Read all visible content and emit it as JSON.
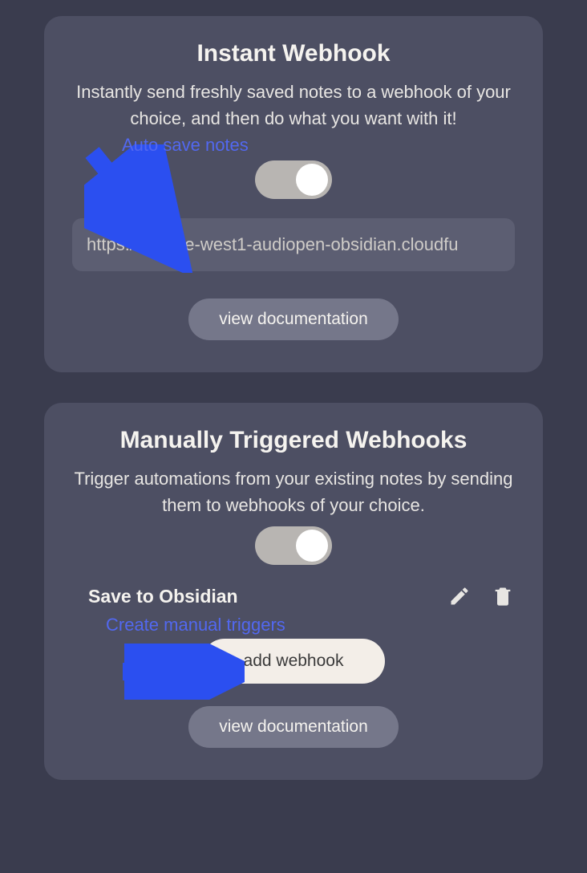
{
  "instant": {
    "title": "Instant Webhook",
    "description": "Instantly send freshly saved notes to a webhook of your choice, and then do what you want with it!",
    "annotation_label": "Auto save notes",
    "toggle_on": true,
    "url_value": "https://europe-west1-audiopen-obsidian.cloudfu",
    "doc_button": "view documentation"
  },
  "manual": {
    "title": "Manually Triggered Webhooks",
    "description": "Trigger automations from your existing notes by sending them to webhooks of your choice.",
    "toggle_on": true,
    "webhooks": [
      {
        "name": "Save to Obsidian"
      }
    ],
    "annotation_label": "Create manual triggers",
    "add_button": "add webhook",
    "doc_button": "view documentation"
  },
  "colors": {
    "accent": "#5268f0",
    "card_bg": "#4d4f63",
    "page_bg": "#3a3c4e"
  }
}
